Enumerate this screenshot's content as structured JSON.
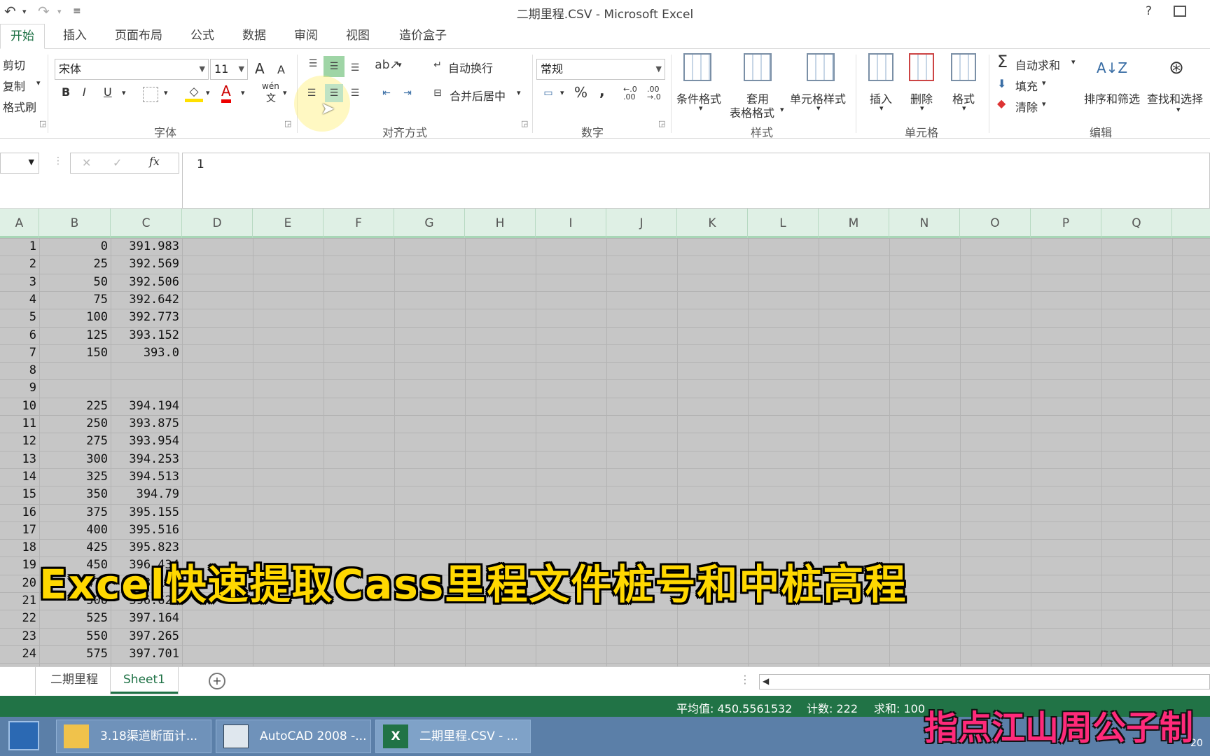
{
  "window": {
    "title": "二期里程.CSV - Microsoft Excel",
    "help": "?",
    "restore_icon": "restore-icon"
  },
  "tabs": [
    "开始",
    "插入",
    "页面布局",
    "公式",
    "数据",
    "审阅",
    "视图",
    "造价盒子"
  ],
  "ribbon": {
    "clipboard": {
      "cut": "剪切",
      "copy": "复制",
      "format_painter": "格式刷"
    },
    "font": {
      "name": "宋体",
      "size": "11",
      "bold": "B",
      "italic": "I",
      "underline": "U",
      "color_letter": "A",
      "phonetic": "wén",
      "phonetic_sub": "文",
      "group": "字体",
      "grow": "A",
      "shrink": "A"
    },
    "alignment": {
      "wrap": "自动换行",
      "merge": "合并后居中",
      "group": "对齐方式"
    },
    "number": {
      "format": "常规",
      "percent": "%",
      "comma": ",",
      "inc_decimal": "←.0 .00",
      "dec_decimal": ".00 →.0",
      "group": "数字"
    },
    "styles": {
      "conditional": "条件格式",
      "table_line1": "套用",
      "table_line2": "表格格式",
      "cell_styles": "单元格样式",
      "group": "样式"
    },
    "cells": {
      "insert": "插入",
      "delete": "删除",
      "format": "格式",
      "group": "单元格"
    },
    "editing": {
      "autosum": "自动求和",
      "fill": "填充",
      "clear": "清除",
      "sort": "排序和筛选",
      "find": "查找和选择",
      "group": "编辑"
    }
  },
  "formula_bar": {
    "value": "1",
    "fx": "fx",
    "cancel": "✕",
    "enter": "✓"
  },
  "columns": [
    "A",
    "B",
    "C",
    "D",
    "E",
    "F",
    "G",
    "H",
    "I",
    "J",
    "K",
    "L",
    "M",
    "N",
    "O",
    "P",
    "Q"
  ],
  "rows": [
    {
      "a": "1",
      "b": "0",
      "c": "391.983"
    },
    {
      "a": "2",
      "b": "25",
      "c": "392.569"
    },
    {
      "a": "3",
      "b": "50",
      "c": "392.506"
    },
    {
      "a": "4",
      "b": "75",
      "c": "392.642"
    },
    {
      "a": "5",
      "b": "100",
      "c": "392.773"
    },
    {
      "a": "6",
      "b": "125",
      "c": "393.152"
    },
    {
      "a": "7",
      "b": "150",
      "c": "393.0"
    },
    {
      "a": "8",
      "b": "",
      "c": ""
    },
    {
      "a": "9",
      "b": "",
      "c": ""
    },
    {
      "a": "10",
      "b": "225",
      "c": "394.194"
    },
    {
      "a": "11",
      "b": "250",
      "c": "393.875"
    },
    {
      "a": "12",
      "b": "275",
      "c": "393.954"
    },
    {
      "a": "13",
      "b": "300",
      "c": "394.253"
    },
    {
      "a": "14",
      "b": "325",
      "c": "394.513"
    },
    {
      "a": "15",
      "b": "350",
      "c": "394.79"
    },
    {
      "a": "16",
      "b": "375",
      "c": "395.155"
    },
    {
      "a": "17",
      "b": "400",
      "c": "395.516"
    },
    {
      "a": "18",
      "b": "425",
      "c": "395.823"
    },
    {
      "a": "19",
      "b": "450",
      "c": "396.434"
    },
    {
      "a": "20",
      "b": "475",
      "c": "398.103"
    },
    {
      "a": "21",
      "b": "500",
      "c": "396.627"
    },
    {
      "a": "22",
      "b": "525",
      "c": "397.164"
    },
    {
      "a": "23",
      "b": "550",
      "c": "397.265"
    },
    {
      "a": "24",
      "b": "575",
      "c": "397.701"
    }
  ],
  "banner": "Excel快速提取Cass里程文件桩号和中桩高程",
  "sheet_tabs": [
    "二期里程",
    "Sheet1"
  ],
  "add_sheet": "+",
  "status": {
    "average": "平均值: 450.5561532",
    "count": "计数: 222",
    "sum": "求和: 100"
  },
  "taskbar": [
    {
      "label": "3.18渠道断面计...",
      "icon": "folder-icon"
    },
    {
      "label": "AutoCAD 2008 -...",
      "icon": "autocad-icon"
    },
    {
      "label": "二期里程.CSV - ...",
      "icon": "excel-icon"
    }
  ],
  "taskbar_clock": "20",
  "watermark": "指点江山周公子制",
  "colors": {
    "excel_green": "#217346",
    "banner_yellow": "#ffd800",
    "watermark_pink": "#ff2a7a"
  }
}
